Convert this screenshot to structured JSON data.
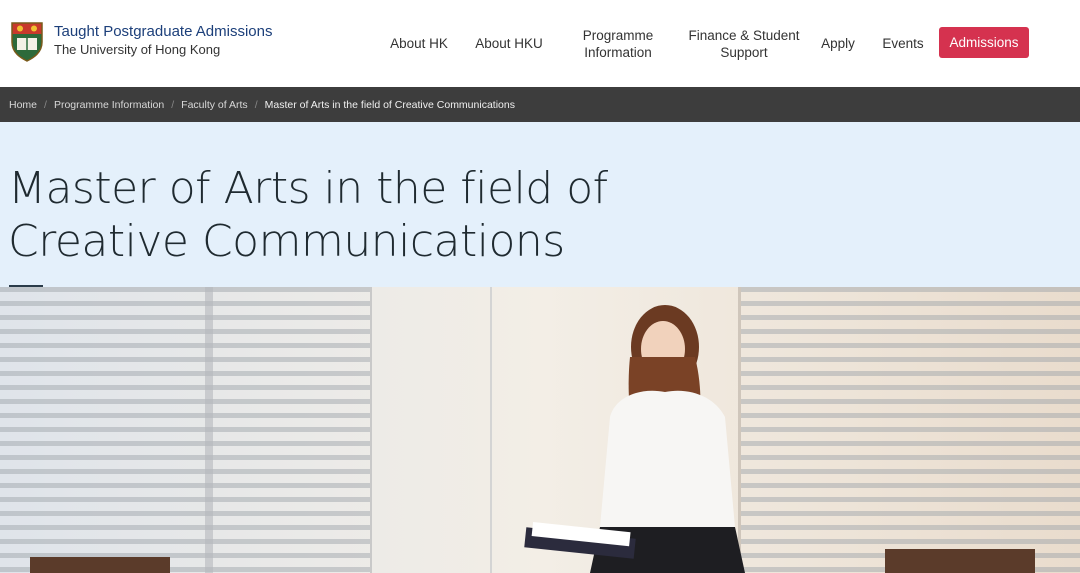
{
  "brand": {
    "title": "Taught Postgraduate Admissions",
    "subtitle": "The University of Hong Kong"
  },
  "nav": {
    "items": [
      {
        "label": "About HK"
      },
      {
        "label": "About HKU"
      },
      {
        "label": "Programme Information"
      },
      {
        "label": "Finance & Student Support"
      },
      {
        "label": "Apply"
      },
      {
        "label": "Events"
      }
    ],
    "cta": "Admissions"
  },
  "breadcrumb": {
    "items": [
      "Home",
      "Programme Information",
      "Faculty of Arts"
    ],
    "current": "Master of Arts in the field of Creative Communications"
  },
  "page": {
    "title": "Master of Arts in the field of Creative Communications"
  },
  "colors": {
    "brand_blue": "#1c3f7a",
    "cta_red": "#d5324f",
    "breadcrumb_bg": "#3d3d3d",
    "title_band": "#e4f0fb"
  },
  "icons": [
    "hku-crest-icon"
  ]
}
